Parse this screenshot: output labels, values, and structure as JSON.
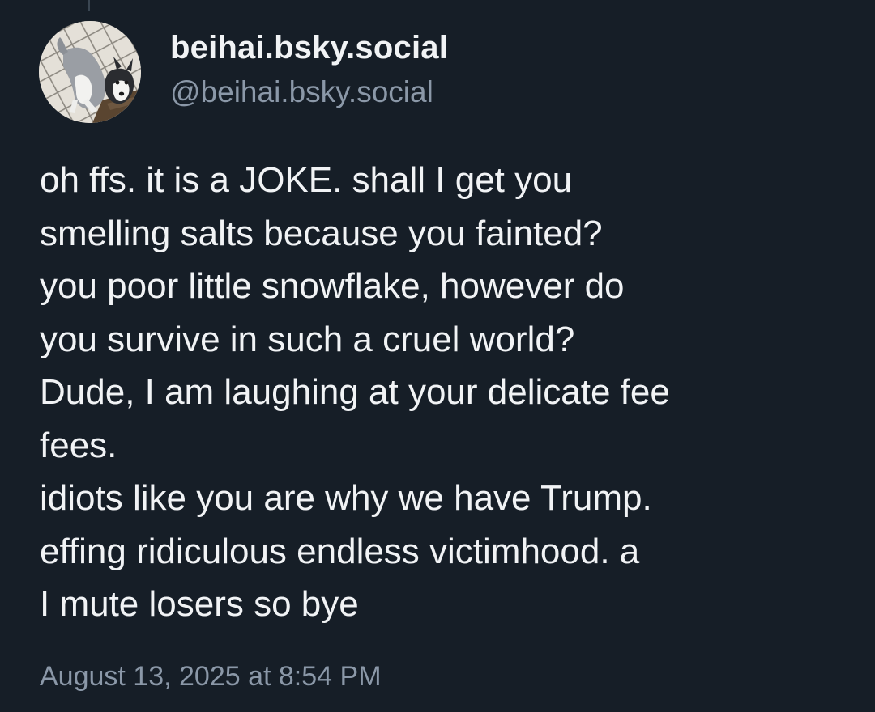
{
  "post": {
    "author": {
      "display_name": "beihai.bsky.social",
      "handle": "@beihai.bsky.social",
      "avatar": "husky-dog-avatar"
    },
    "text": "oh ffs. it is a JOKE. shall I get you\nsmelling salts because you fainted?\nyou poor little snowflake, however do\nyou survive in such a cruel world?\nDude, I am laughing at your delicate fee\nfees.\nidiots like you are why we have Trump.\neffing ridiculous endless victimhood. a\nI mute losers so bye",
    "timestamp": "August 13, 2025 at 8:54 PM"
  },
  "colors": {
    "background": "#161e27",
    "text": "#f1f3f5",
    "muted": "#8b98a8",
    "thread_line": "#3a4652"
  }
}
